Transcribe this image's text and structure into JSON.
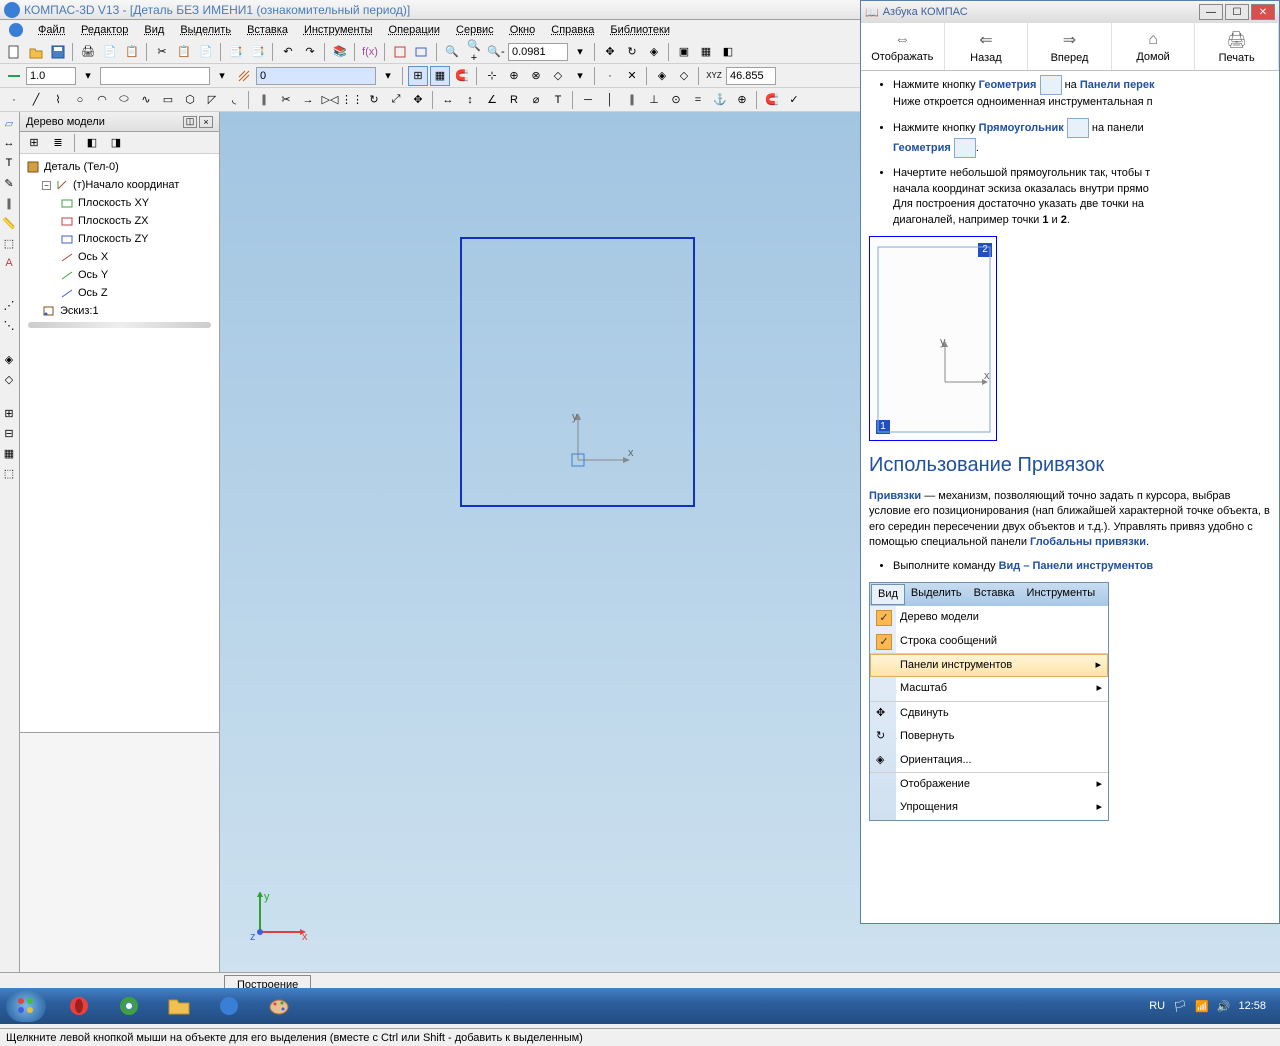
{
  "title": "КОМПАС-3D V13 - [Деталь БЕЗ ИМЕНИ1 (ознакомительный период)]",
  "menu": [
    "Файл",
    "Редактор",
    "Вид",
    "Выделить",
    "Вставка",
    "Инструменты",
    "Операции",
    "Сервис",
    "Окно",
    "Справка",
    "Библиотеки"
  ],
  "toolbar3": {
    "step": "1.0",
    "style": "0",
    "coords": "46.855"
  },
  "zoom_value": "0.0981",
  "tree": {
    "title": "Дерево модели",
    "root": "Деталь (Тел-0)",
    "origin": "(т)Начало координат",
    "items": [
      "Плоскость XY",
      "Плоскость ZX",
      "Плоскость ZY",
      "Ось X",
      "Ось Y",
      "Ось Z"
    ],
    "sketch": "Эскиз:1"
  },
  "build_tab": "Построение",
  "status_text": "Щелкните левой кнопкой мыши на объекте для его выделения (вместе с Ctrl или Shift - добавить к выделенным)",
  "help": {
    "title": "Азбука КОМПАС",
    "nav": [
      "Отображать",
      "Назад",
      "Вперед",
      "Домой",
      "Печать"
    ],
    "li1a": "Нажмите кнопку ",
    "li1b": "Геометрия",
    "li1c": " на ",
    "li1d": "Панели перек",
    "li1e": "Ниже откроется одноименная инструментальная п",
    "li2a": "Нажмите кнопку ",
    "li2b": "Прямоугольник",
    "li2c": " на панели ",
    "li2d": "Геометрия",
    "li3a": "Начертите небольшой прямоугольник так, чтобы т",
    "li3b": "начала координат эскиза оказалась внутри прямо",
    "li3c": "Для построения достаточно указать две точки на",
    "li3d": "диагоналей, например точки ",
    "li3e": "1",
    "li3f": " и ",
    "li3g": "2",
    "section": "Использование Привязок",
    "p1a": "Привязки",
    "p1b": " — механизм, позволяющий точно задать п курсора, выбрав условие его позиционирования (нап ближайшей характерной точке объекта, в его середин пересечении двух объектов и т.д.). Управлять привяз удобно с помощью специальной панели ",
    "p1c": "Глобальны привязки",
    "li4a": "Выполните команду ",
    "li4b": "Вид – Панели инструментов",
    "embed_menu_bar": [
      "Вид",
      "Выделить",
      "Вставка",
      "Инструменты"
    ],
    "embed_items": {
      "m1": "Дерево модели",
      "m2": "Строка сообщений",
      "m3": "Панели инструментов",
      "m4": "Масштаб",
      "m5": "Сдвинуть",
      "m6": "Повернуть",
      "m7": "Ориентация...",
      "m8": "Отображение",
      "m9": "Упрощения"
    }
  },
  "tray": {
    "lang": "RU",
    "time": "12:58"
  },
  "axis": {
    "x": "x",
    "y": "y",
    "z": "z"
  },
  "diagram": {
    "y": "y",
    "x": "x"
  }
}
